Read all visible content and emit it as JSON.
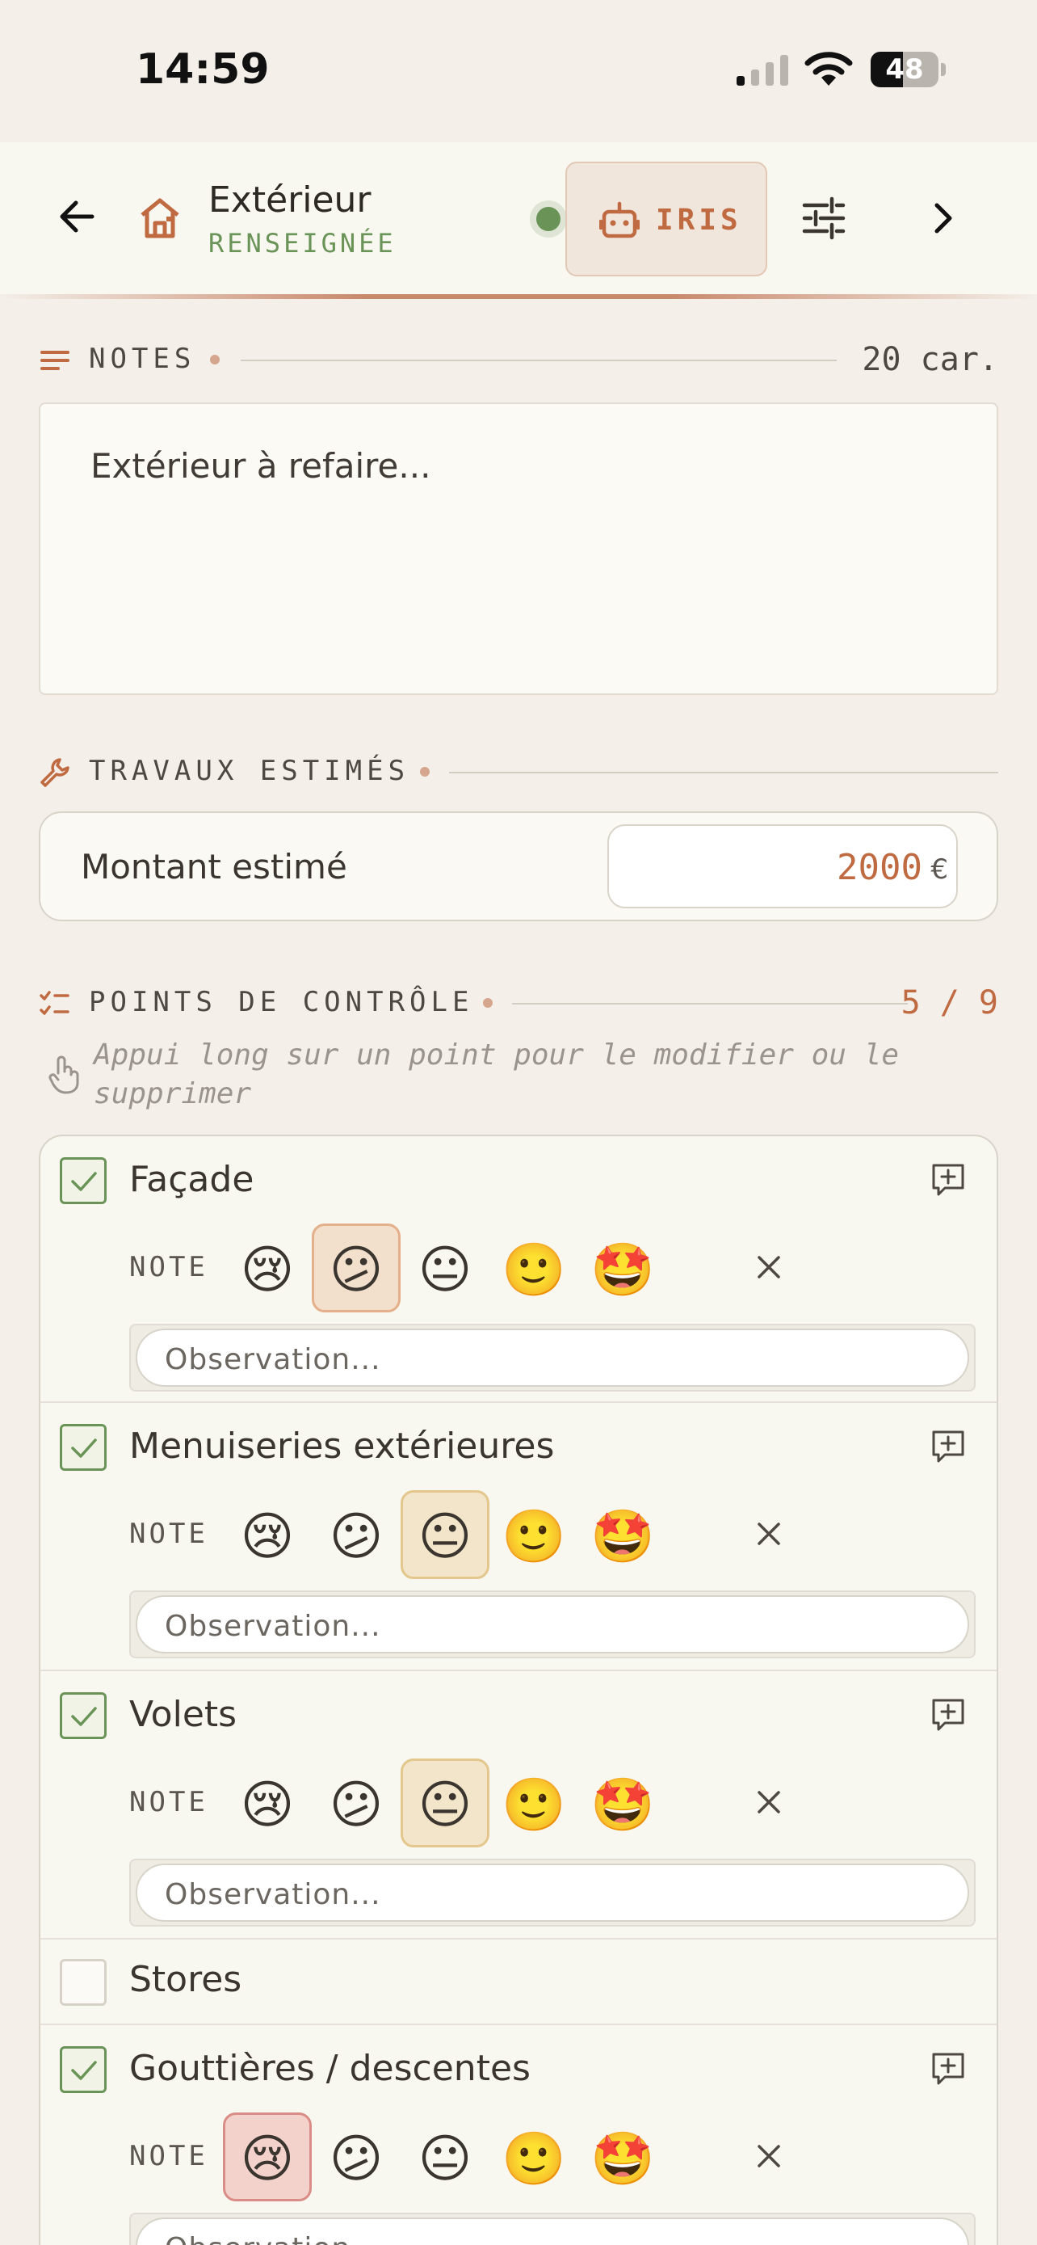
{
  "status_bar": {
    "time": "14:59",
    "battery": "48",
    "battery_level": 0.48
  },
  "header": {
    "title": "Extérieur",
    "status": "RENSEIGNÉE",
    "assistant_label": "IRIS"
  },
  "notes": {
    "section_title": "NOTES",
    "count": "20 car.",
    "text": "Extérieur à refaire..."
  },
  "works": {
    "section_title": "TRAVAUX ESTIMÉS",
    "amount_label": "Montant estimé",
    "amount_value": "2000",
    "currency": "€"
  },
  "checklist": {
    "section_title": "POINTS DE CONTRÔLE",
    "count": "5 / 9",
    "hint": "Appui long sur un point pour le modifier ou le supprimer",
    "note_label": "NOTE",
    "observation_placeholder": "Observation...",
    "emojis": [
      "😢",
      "😕",
      "😐",
      "🙂",
      "🤩"
    ],
    "items": [
      {
        "name": "Façade",
        "checked": true,
        "rating": 1
      },
      {
        "name": "Menuiseries extérieures",
        "checked": true,
        "rating": 2
      },
      {
        "name": "Volets",
        "checked": true,
        "rating": 2
      },
      {
        "name": "Stores",
        "checked": false
      },
      {
        "name": "Gouttières / descentes",
        "checked": true,
        "rating": 0
      }
    ]
  },
  "colors": {
    "accent": "#c06a42",
    "success": "#6a9457",
    "background": "#f4efe9"
  }
}
